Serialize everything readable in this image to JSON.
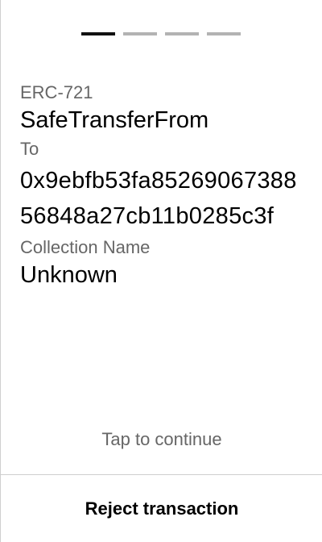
{
  "progress": {
    "total_steps": 4,
    "current_step": 1
  },
  "transaction": {
    "standard_label": "ERC-721",
    "method": "SafeTransferFrom",
    "to_label": "To",
    "to_address": "0x9ebfb53fa8526906738856848a27cb11b0285c3f",
    "collection_label": "Collection Name",
    "collection_value": "Unknown"
  },
  "hint": {
    "tap_to_continue": "Tap to continue"
  },
  "actions": {
    "reject_label": "Reject transaction"
  },
  "colors": {
    "active_step": "#111111",
    "inactive_step": "#b3b3b3",
    "label_gray": "#666666",
    "divider": "#cfcfcf"
  }
}
